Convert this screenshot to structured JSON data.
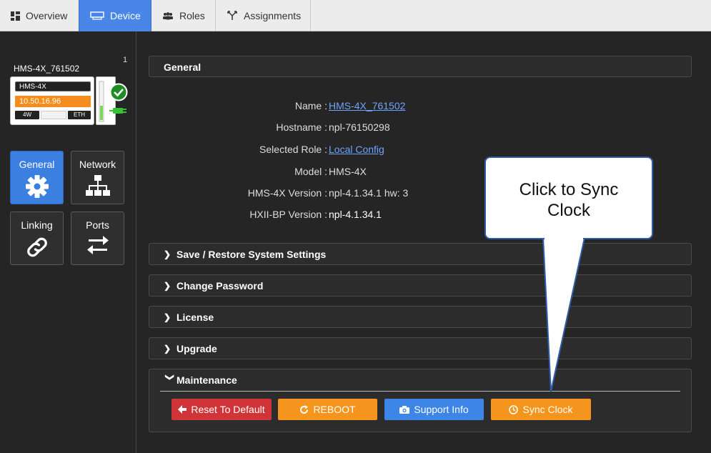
{
  "tabs": [
    {
      "label": "Overview",
      "icon": "dashboard-icon",
      "active": false
    },
    {
      "label": "Device",
      "icon": "device-icon",
      "active": true
    },
    {
      "label": "Roles",
      "icon": "users-icon",
      "active": false
    },
    {
      "label": "Assignments",
      "icon": "assignments-icon",
      "active": false
    }
  ],
  "device": {
    "count": "1",
    "name": "HMS-4X_761502",
    "model_badge": "HMS-4X",
    "ip": "10.50.16.96",
    "badge_left": "4W",
    "badge_right": "ETH",
    "status": "online"
  },
  "side_tiles": [
    {
      "label": "General",
      "icon": "gear-icon",
      "active": true
    },
    {
      "label": "Network",
      "icon": "network-icon",
      "active": false
    },
    {
      "label": "Linking",
      "icon": "link-icon",
      "active": false
    },
    {
      "label": "Ports",
      "icon": "arrows-icon",
      "active": false
    }
  ],
  "general": {
    "title": "General",
    "rows": [
      {
        "label": "Name :",
        "value": "HMS-4X_761502"
      },
      {
        "label": "Hostname :",
        "value": "npl-76150298"
      },
      {
        "label": "Selected Role :",
        "value": "Local Config"
      },
      {
        "label": "Model :",
        "value": "HMS-4X"
      },
      {
        "label": "HMS-4X Version :",
        "value": "npl-4.1.34.1 hw: 3"
      },
      {
        "label": "HXII-BP Version :",
        "value": "npl-4.1.34.1"
      }
    ]
  },
  "sections": {
    "save_restore": "Save / Restore System Settings",
    "change_password": "Change Password",
    "license": "License",
    "upgrade": "Upgrade",
    "maintenance": "Maintenance"
  },
  "maintenance_buttons": {
    "reset": "Reset To Default",
    "reboot": "REBOOT",
    "support": "Support Info",
    "sync": "Sync Clock"
  },
  "colors": {
    "accent": "#4a86e8",
    "reset": "#d13438",
    "orange": "#f5951e",
    "support": "#3d85e6"
  },
  "callout": {
    "line1": "Click to Sync",
    "line2": "Clock"
  }
}
